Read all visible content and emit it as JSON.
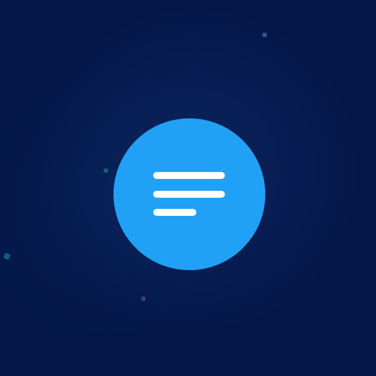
{
  "theme": {
    "background": "#03174a",
    "button": "#21a1f6",
    "icon": "#ffffff"
  },
  "decorations": [
    {
      "name": "particle-top-right",
      "color": "#4f57a0"
    },
    {
      "name": "particle-mid-left",
      "color": "#0f6f77"
    },
    {
      "name": "particle-left-edge",
      "color": "#0d6f7d"
    },
    {
      "name": "particle-bottom",
      "color": "#5a3e79"
    }
  ],
  "menu_button": {
    "icon_name": "menu-icon",
    "aria_label": "Menu"
  }
}
